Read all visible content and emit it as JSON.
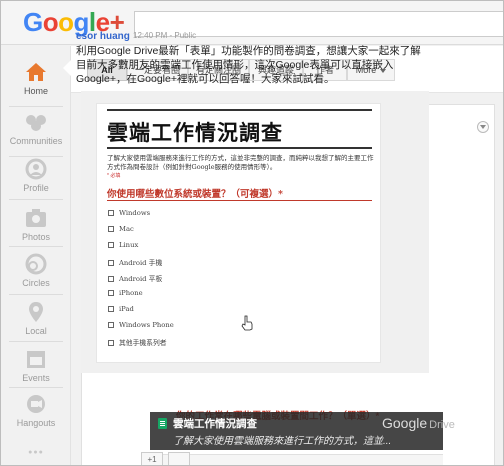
{
  "app": {
    "logo_text": "Google+",
    "logo_colors": [
      "#4285f4",
      "#ea4335",
      "#fbbc05",
      "#4285f4",
      "#34a853",
      "#ea4335",
      "#dd4b39"
    ]
  },
  "search": {
    "placeholder": ""
  },
  "sidebar": {
    "items": [
      {
        "label": "Home",
        "icon": "home-icon",
        "active": true
      },
      {
        "label": "Communities",
        "icon": "communities-icon"
      },
      {
        "label": "Profile",
        "icon": "profile-icon"
      },
      {
        "label": "Photos",
        "icon": "photos-icon"
      },
      {
        "label": "Circles",
        "icon": "circles-icon"
      },
      {
        "label": "Local",
        "icon": "local-icon"
      },
      {
        "label": "Events",
        "icon": "events-icon"
      },
      {
        "label": "Hangouts",
        "icon": "hangouts-icon"
      }
    ],
    "more_glyph": "●●●"
  },
  "filters": [
    {
      "label": "All",
      "active": true
    },
    {
      "label": "一定要看圈"
    },
    {
      "label": "有定關注圈"
    },
    {
      "label": "興趣追蹤"
    },
    {
      "label": "作者"
    },
    {
      "label": "More",
      "dropdown": true
    }
  ],
  "post": {
    "author": "esor huang",
    "time": "12:40 PM",
    "visibility": "Public",
    "text": "利用Google Drive最新「表單」功能製作的問卷調查，想讓大家一起來了解目前大多數朋友的雲端工作使用情形，這次Google表單可以直接嵌入Google+，在Google+裡就可以回答喔！大家來試試看。"
  },
  "form": {
    "title": "雲端工作情況調查",
    "description": "了解大家使用雲端服務來進行工作的方式，這並非完整的調查，而純粹以我想了解的主要工作方式作為問卷設計（例如針對Google服務的使用情形等）。",
    "required_note": "* 必填",
    "question": "你使用哪些數位系統或裝置？（可複選）*",
    "options": [
      "Windows",
      "Mac",
      "Linux",
      "Android 手機",
      "Android 平板",
      "iPhone",
      "iPad",
      "Windows Phone",
      "其他手機系列者"
    ],
    "next_question": "你的工作常在哪些電腦或裝置間工作？（單選）*"
  },
  "overlay": {
    "title": "雲端工作情況調查",
    "subtitle": "了解大家使用雲端服務來進行工作的方式，這並...",
    "brand": "Google",
    "brand_suffix": "Drive"
  },
  "actions": {
    "plus_label": "+1"
  }
}
